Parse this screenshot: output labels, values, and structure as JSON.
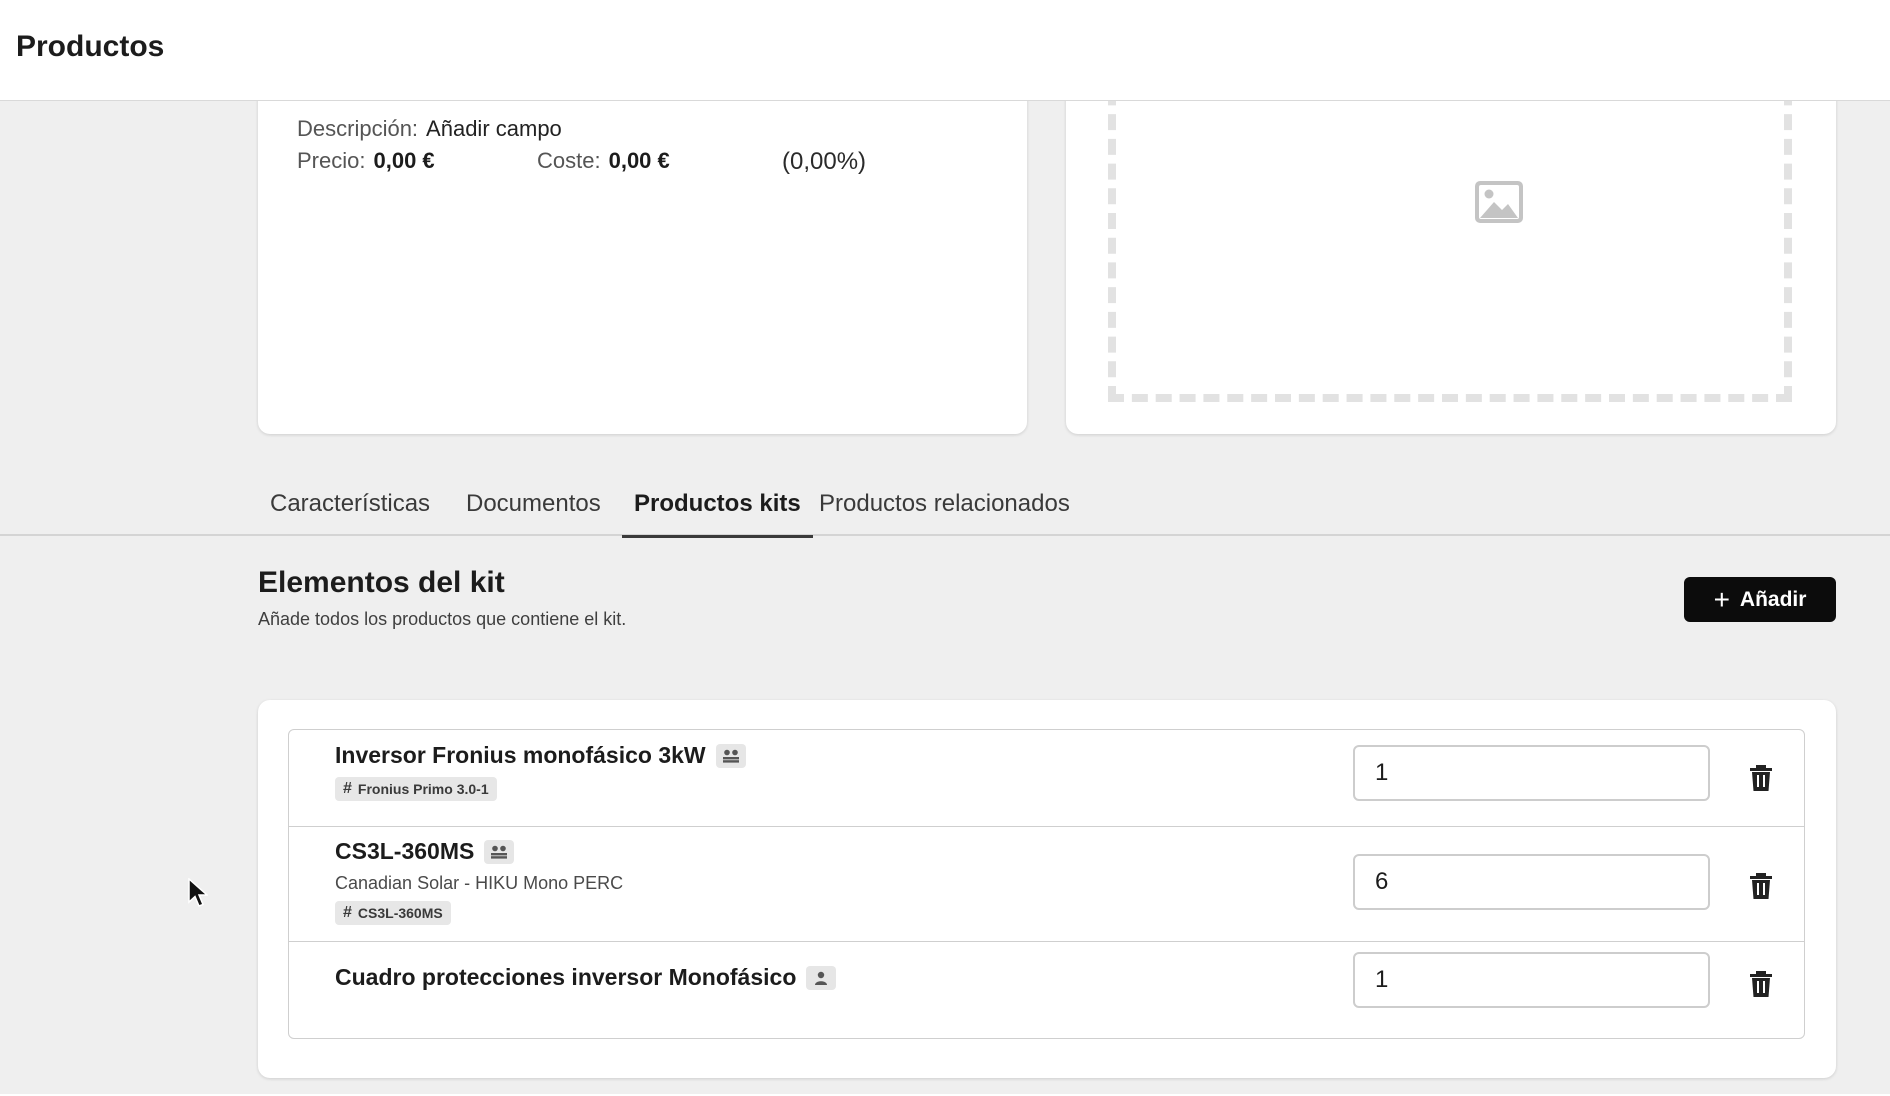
{
  "header": {
    "title": "Productos"
  },
  "product_info": {
    "description_label": "Descripción:",
    "description_value": "Añadir campo",
    "price_label": "Precio:",
    "price_value": "0,00 €",
    "cost_label": "Coste:",
    "cost_value": "0,00 €",
    "margin_pct": "(0,00%)"
  },
  "image_placeholder": {
    "icon": "image-icon"
  },
  "tabs": [
    {
      "label": "Características",
      "active": false
    },
    {
      "label": "Documentos",
      "active": false
    },
    {
      "label": "Productos kits",
      "active": true
    },
    {
      "label": "Productos relacionados",
      "active": false
    }
  ],
  "kit_section": {
    "title": "Elementos del kit",
    "subtitle": "Añade todos los productos que contiene el kit.",
    "add_button_label": "Añadir",
    "items": [
      {
        "name": "Inversor Fronius monofásico 3kW",
        "type_icon": "group-icon",
        "subtitle": "",
        "reference": "Fronius Primo 3.0-1",
        "quantity": "1"
      },
      {
        "name": "CS3L-360MS",
        "type_icon": "group-icon",
        "subtitle": "Canadian Solar - HIKU Mono PERC",
        "reference": "CS3L-360MS",
        "quantity": "6"
      },
      {
        "name": "Cuadro protecciones inversor Monofásico",
        "type_icon": "person-icon",
        "subtitle": "",
        "reference": "",
        "quantity": "1"
      }
    ]
  },
  "colors": {
    "primary_button": "#0c0c0c",
    "background": "#efefef",
    "card": "#ffffff"
  }
}
